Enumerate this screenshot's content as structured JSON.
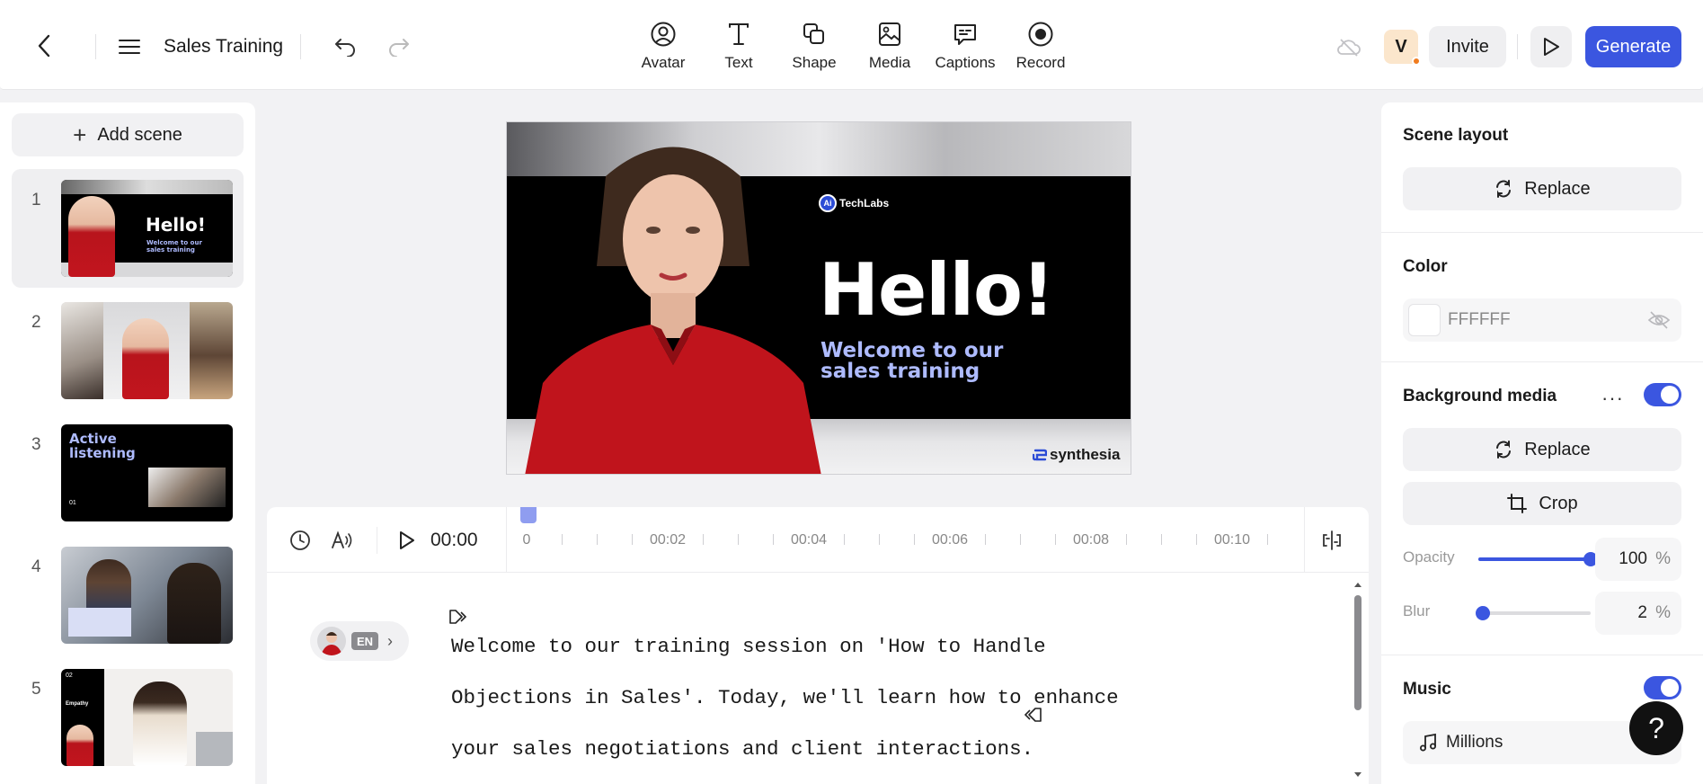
{
  "header": {
    "project_title": "Sales Training",
    "tools": [
      {
        "label": "Avatar",
        "icon": "avatar-icon"
      },
      {
        "label": "Text",
        "icon": "text-icon"
      },
      {
        "label": "Shape",
        "icon": "shape-icon"
      },
      {
        "label": "Media",
        "icon": "media-icon"
      },
      {
        "label": "Captions",
        "icon": "captions-icon"
      },
      {
        "label": "Record",
        "icon": "record-icon"
      }
    ],
    "user_initial": "V",
    "invite_label": "Invite",
    "generate_label": "Generate",
    "accent_color": "#3b56e0"
  },
  "scenes": {
    "add_label": "Add scene",
    "items": [
      {
        "number": "1",
        "thumb_title": "Hello!",
        "thumb_sub": "Welcome to our sales training",
        "selected": true
      },
      {
        "number": "2",
        "thumb_title": "",
        "thumb_sub": "",
        "selected": false
      },
      {
        "number": "3",
        "thumb_title": "Active listening",
        "thumb_sub": "01",
        "selected": false
      },
      {
        "number": "4",
        "thumb_title": "",
        "thumb_sub": "",
        "selected": false
      },
      {
        "number": "5",
        "thumb_title": "02",
        "thumb_sub": "Empathy",
        "selected": false
      }
    ]
  },
  "canvas": {
    "logo_text": "TechLabs",
    "logo_badge": "Ai",
    "headline": "Hello!",
    "subline": "Welcome to our sales training",
    "brand": "synthesia"
  },
  "timeline": {
    "current_time": "00:00",
    "ticks": [
      "0",
      "00:02",
      "00:04",
      "00:06",
      "00:08",
      "00:10"
    ]
  },
  "script": {
    "language": "EN",
    "text": "Welcome to our training session on 'How to Handle Objections in Sales'. Today, we'll learn how to enhance your sales negotiations and client interactions."
  },
  "properties": {
    "scene_layout": {
      "title": "Scene layout",
      "button": "Replace"
    },
    "color": {
      "title": "Color",
      "value": "FFFFFF"
    },
    "background_media": {
      "title": "Background media",
      "enabled": true,
      "replace_label": "Replace",
      "crop_label": "Crop",
      "opacity_label": "Opacity",
      "opacity_value": "100",
      "blur_label": "Blur",
      "blur_value": "2",
      "unit": "%"
    },
    "music": {
      "title": "Music",
      "enabled": true,
      "track": "Millions"
    }
  },
  "help_label": "?"
}
